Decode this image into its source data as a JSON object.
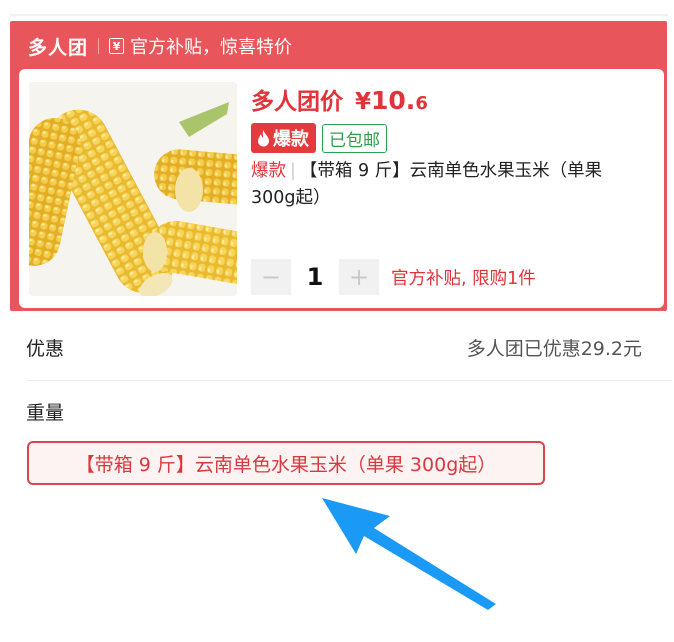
{
  "header": {
    "title": "多人团",
    "icon": "yen-tag-icon",
    "icon_glyph": "¥",
    "subtitle": "官方补贴，惊喜特价"
  },
  "product": {
    "image": "corn-image",
    "price_label": "多人团价",
    "price_currency": "¥",
    "price_main": "10.",
    "price_decimal": "6",
    "badge_hot": "爆款",
    "badge_ship": "已包邮",
    "title_tag": "爆款",
    "title_sep": "|",
    "title_text": "【带箱 9 斤】云南单色水果玉米（单果 300g起）"
  },
  "stepper": {
    "minus": "−",
    "value": "1",
    "plus": "+",
    "limit_text": "官方补贴, 限购1件"
  },
  "discount": {
    "label": "优惠",
    "value": "多人团已优惠29.2元"
  },
  "weight": {
    "label": "重量",
    "option": "【带箱 9 斤】云南单色水果玉米（单果 300g起）"
  },
  "colors": {
    "panel_red": "#e8555a",
    "price_red": "#e2333a",
    "ship_green": "#2aa150",
    "arrow_blue": "#1a9af5"
  }
}
